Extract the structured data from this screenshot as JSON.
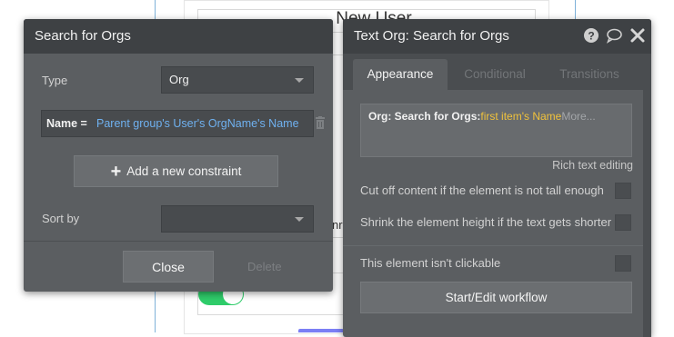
{
  "background": {
    "page_title": "New User",
    "fragment_text": "nr"
  },
  "search_dialog": {
    "title": "Search for Orgs",
    "type_label": "Type",
    "type_value": "Org",
    "constraint": {
      "key": "Name =",
      "value": "Parent group's User's OrgName's Name"
    },
    "add_constraint_label": "Add a new constraint",
    "sort_by_label": "Sort by",
    "sort_by_value": "",
    "close_label": "Close",
    "delete_label": "Delete",
    "icons": [
      "trash-icon",
      "plus-icon",
      "chevron-down-icon"
    ]
  },
  "property_editor": {
    "title": "Text Org: Search for Orgs",
    "header_icons": [
      "help-icon",
      "comment-icon",
      "close-icon"
    ],
    "tabs": [
      {
        "label": "Appearance",
        "active": true
      },
      {
        "label": "Conditional",
        "active": false
      },
      {
        "label": "Transitions",
        "active": false
      }
    ],
    "text_content": {
      "prefix": "Org: Search for Orgs:",
      "dynamic": "first item's Name",
      "more": "More..."
    },
    "rich_text_label": "Rich text editing",
    "options": [
      {
        "label": "Cut off content if the element is not tall enough",
        "checked": false
      },
      {
        "label": "Shrink the element height if the text gets shorter",
        "checked": false
      },
      {
        "label": "This element isn't clickable",
        "checked": false
      }
    ],
    "workflow_button": "Start/Edit workflow"
  },
  "colors": {
    "panel": "#5b5e61",
    "header": "#3e4144",
    "link_blue": "#6fb1f0",
    "dynamic_yellow": "#f0c23c",
    "toggle_green": "#2fcc6a"
  }
}
